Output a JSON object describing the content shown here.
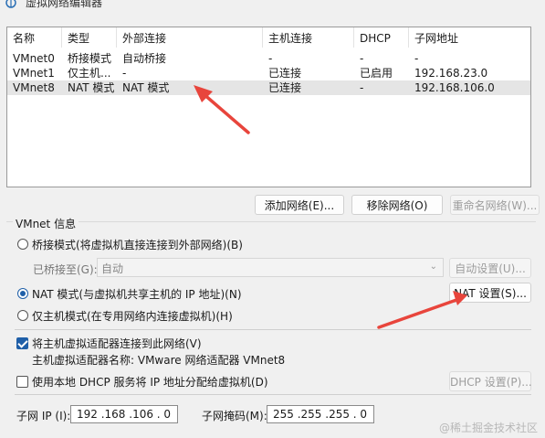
{
  "window": {
    "title": "虚拟网络编辑器"
  },
  "list": {
    "columns": [
      "名称",
      "类型",
      "外部连接",
      "主机连接",
      "DHCP",
      "子网地址"
    ],
    "rows": [
      [
        "VMnet0",
        "桥接模式",
        "自动桥接",
        "-",
        "-",
        "-"
      ],
      [
        "VMnet1",
        "仅主机...",
        "-",
        "已连接",
        "已启用",
        "192.168.23.0"
      ],
      [
        "VMnet8",
        "NAT 模式",
        "NAT 模式",
        "已连接",
        "-",
        "192.168.106.0"
      ]
    ],
    "selected_row": 2
  },
  "buttons": {
    "add_network": "添加网络(E)...",
    "remove_network": "移除网络(O)",
    "rename_network": "重命名网络(W)..."
  },
  "vmnet_info": {
    "group_label": "VMnet 信息",
    "bridge_mode": "桥接模式(将虚拟机直接连接到外部网络)(B)",
    "bridged_to_label": "已桥接至(G):",
    "bridged_to_value": "自动",
    "auto_settings": "自动设置(U)...",
    "nat_mode": "NAT 模式(与虚拟机共享主机的 IP 地址)(N)",
    "nat_settings": "NAT 设置(S)...",
    "host_only_mode": "仅主机模式(在专用网络内连接虚拟机)(H)",
    "connect_adapter": "将主机虚拟适配器连接到此网络(V)",
    "adapter_name": "主机虚拟适配器名称: VMware 网络适配器 VMnet8",
    "use_dhcp": "使用本地 DHCP 服务将 IP 地址分配给虚拟机(D)",
    "dhcp_settings": "DHCP 设置(P)...",
    "subnet_ip_label": "子网 IP (I):",
    "subnet_ip_value": "192 .168 .106 . 0",
    "subnet_mask_label": "子网掩码(M):",
    "subnet_mask_value": "255 .255 .255 . 0"
  },
  "watermark": "@稀土掘金技术社区",
  "colors": {
    "accent": "#1f5fa8",
    "arrow": "#e8453c"
  }
}
